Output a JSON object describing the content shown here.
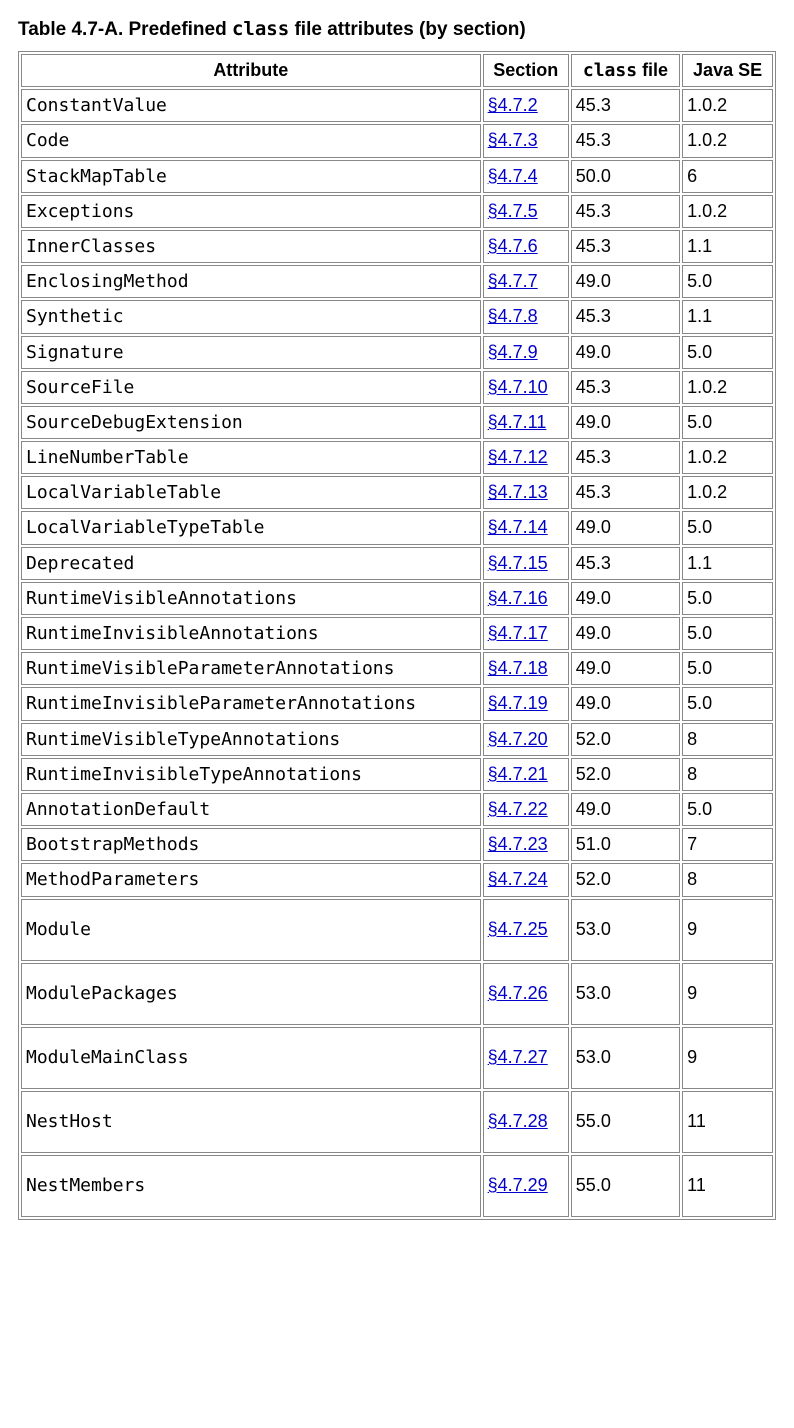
{
  "caption": {
    "prefix": "Table 4.7-A. Predefined ",
    "code": "class",
    "suffix": " file attributes (by section)"
  },
  "headers": {
    "attribute": "Attribute",
    "section": "Section",
    "classfile_code": "class",
    "classfile_suffix": " file",
    "javase": "Java SE"
  },
  "chart_data": {
    "type": "table",
    "columns": [
      "Attribute",
      "Section",
      "class file",
      "Java SE"
    ],
    "rows": [
      {
        "attribute": "ConstantValue",
        "section": "§4.7.2",
        "classfile": "45.3",
        "javase": "1.0.2",
        "tall": false
      },
      {
        "attribute": "Code",
        "section": "§4.7.3",
        "classfile": "45.3",
        "javase": "1.0.2",
        "tall": false
      },
      {
        "attribute": "StackMapTable",
        "section": "§4.7.4",
        "classfile": "50.0",
        "javase": "6",
        "tall": false
      },
      {
        "attribute": "Exceptions",
        "section": "§4.7.5",
        "classfile": "45.3",
        "javase": "1.0.2",
        "tall": false
      },
      {
        "attribute": "InnerClasses",
        "section": "§4.7.6",
        "classfile": "45.3",
        "javase": "1.1",
        "tall": false
      },
      {
        "attribute": "EnclosingMethod",
        "section": "§4.7.7",
        "classfile": "49.0",
        "javase": "5.0",
        "tall": false
      },
      {
        "attribute": "Synthetic",
        "section": "§4.7.8",
        "classfile": "45.3",
        "javase": "1.1",
        "tall": false
      },
      {
        "attribute": "Signature",
        "section": "§4.7.9",
        "classfile": "49.0",
        "javase": "5.0",
        "tall": false
      },
      {
        "attribute": "SourceFile",
        "section": "§4.7.10",
        "classfile": "45.3",
        "javase": "1.0.2",
        "tall": false
      },
      {
        "attribute": "SourceDebugExtension",
        "section": "§4.7.11",
        "classfile": "49.0",
        "javase": "5.0",
        "tall": false
      },
      {
        "attribute": "LineNumberTable",
        "section": "§4.7.12",
        "classfile": "45.3",
        "javase": "1.0.2",
        "tall": false
      },
      {
        "attribute": "LocalVariableTable",
        "section": "§4.7.13",
        "classfile": "45.3",
        "javase": "1.0.2",
        "tall": false
      },
      {
        "attribute": "LocalVariableTypeTable",
        "section": "§4.7.14",
        "classfile": "49.0",
        "javase": "5.0",
        "tall": false
      },
      {
        "attribute": "Deprecated",
        "section": "§4.7.15",
        "classfile": "45.3",
        "javase": "1.1",
        "tall": false
      },
      {
        "attribute": "RuntimeVisibleAnnotations",
        "section": "§4.7.16",
        "classfile": "49.0",
        "javase": "5.0",
        "tall": false
      },
      {
        "attribute": "RuntimeInvisibleAnnotations",
        "section": "§4.7.17",
        "classfile": "49.0",
        "javase": "5.0",
        "tall": false
      },
      {
        "attribute": "RuntimeVisibleParameterAnnotations",
        "section": "§4.7.18",
        "classfile": "49.0",
        "javase": "5.0",
        "tall": false
      },
      {
        "attribute": "RuntimeInvisibleParameterAnnotations",
        "section": "§4.7.19",
        "classfile": "49.0",
        "javase": "5.0",
        "tall": false
      },
      {
        "attribute": "RuntimeVisibleTypeAnnotations",
        "section": "§4.7.20",
        "classfile": "52.0",
        "javase": "8",
        "tall": false
      },
      {
        "attribute": "RuntimeInvisibleTypeAnnotations",
        "section": "§4.7.21",
        "classfile": "52.0",
        "javase": "8",
        "tall": false
      },
      {
        "attribute": "AnnotationDefault",
        "section": "§4.7.22",
        "classfile": "49.0",
        "javase": "5.0",
        "tall": false
      },
      {
        "attribute": "BootstrapMethods",
        "section": "§4.7.23",
        "classfile": "51.0",
        "javase": "7",
        "tall": false
      },
      {
        "attribute": "MethodParameters",
        "section": "§4.7.24",
        "classfile": "52.0",
        "javase": "8",
        "tall": false
      },
      {
        "attribute": "Module",
        "section": "§4.7.25",
        "classfile": "53.0",
        "javase": "9",
        "tall": true
      },
      {
        "attribute": "ModulePackages",
        "section": "§4.7.26",
        "classfile": "53.0",
        "javase": "9",
        "tall": true
      },
      {
        "attribute": "ModuleMainClass",
        "section": "§4.7.27",
        "classfile": "53.0",
        "javase": "9",
        "tall": true
      },
      {
        "attribute": "NestHost",
        "section": "§4.7.28",
        "classfile": "55.0",
        "javase": "11",
        "tall": true
      },
      {
        "attribute": "NestMembers",
        "section": "§4.7.29",
        "classfile": "55.0",
        "javase": "11",
        "tall": true
      }
    ]
  }
}
